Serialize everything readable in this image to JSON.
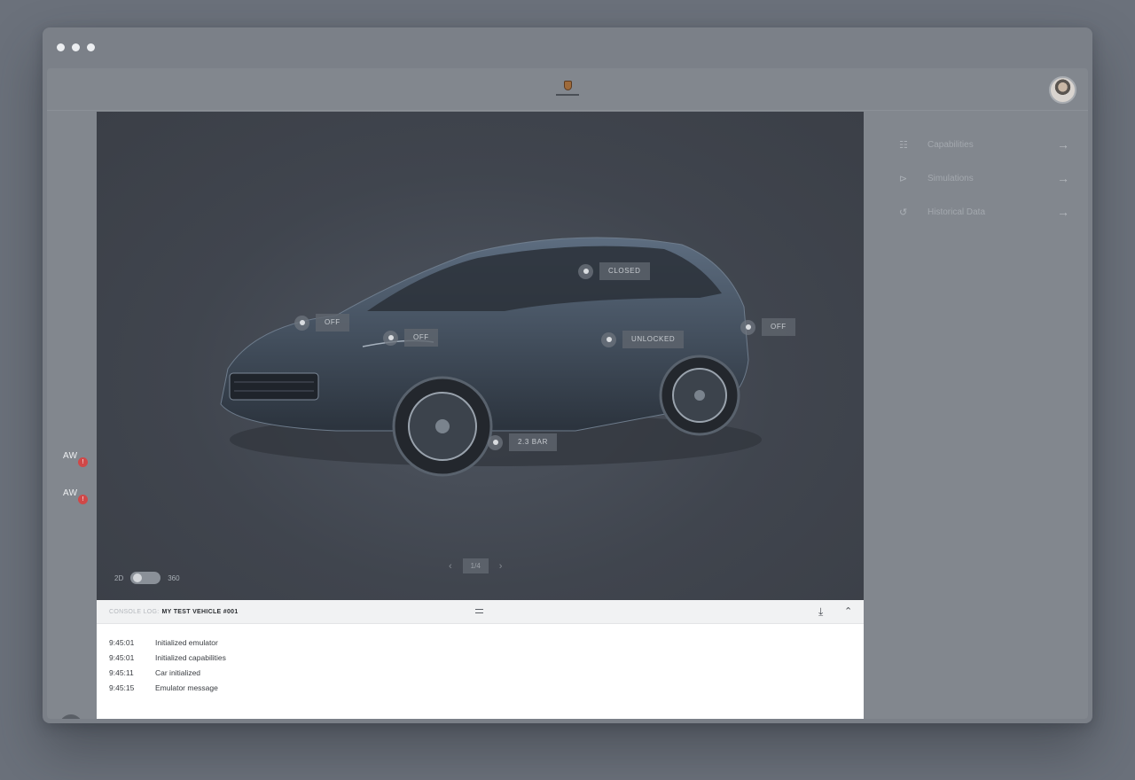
{
  "app": {
    "brand": "PORSCHE"
  },
  "left_rail": {
    "alerts": [
      {
        "label": "AW",
        "badge": "!"
      },
      {
        "label": "AW",
        "badge": "!"
      }
    ],
    "bluetooth_icon": "bluetooth-icon"
  },
  "stage": {
    "tags": [
      {
        "id": "closed",
        "text": "CLOSED"
      },
      {
        "id": "off-front",
        "text": "OFF"
      },
      {
        "id": "off-headlight",
        "text": "OFF"
      },
      {
        "id": "unlocked",
        "text": "UNLOCKED"
      },
      {
        "id": "off-rear",
        "text": "OFF"
      },
      {
        "id": "tire",
        "text": "2.3 BAR"
      }
    ],
    "view_toggle": {
      "left": "2D",
      "right": "360"
    },
    "pager": {
      "prev": "‹",
      "page": "1/4",
      "next": "›"
    }
  },
  "console": {
    "prefix": "CONSOLE LOG:",
    "vehicle": "MY TEST VEHICLE #001",
    "download_glyph": "⤓",
    "collapse_glyph": "⌃",
    "entries": [
      {
        "time": "9:45:01",
        "message": "Initialized emulator"
      },
      {
        "time": "9:45:01",
        "message": "Initialized capabilities"
      },
      {
        "time": "9:45:11",
        "message": "Car initialized"
      },
      {
        "time": "9:45:15",
        "message": "Emulator message"
      }
    ]
  },
  "menu": {
    "items": [
      {
        "label": "Capabilities",
        "icon": "capabilities-icon",
        "glyph": "☷"
      },
      {
        "label": "Simulations",
        "icon": "simulations-icon",
        "glyph": "⊳"
      },
      {
        "label": "Historical Data",
        "icon": "history-icon",
        "glyph": "↺"
      }
    ],
    "arrow": "→"
  },
  "colors": {
    "background": "#6b717b",
    "app": "#82878e",
    "stage": "#3b3f47",
    "badge": "#d04848"
  }
}
